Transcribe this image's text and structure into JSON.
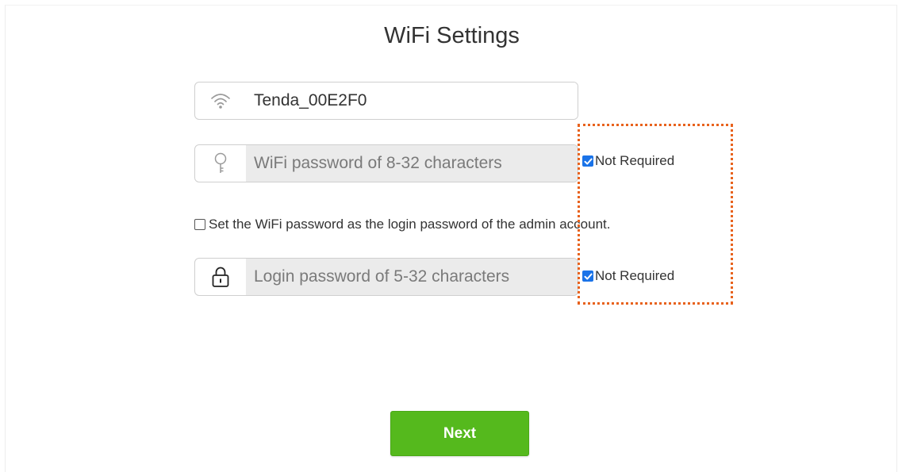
{
  "page": {
    "title": "WiFi Settings"
  },
  "wifi_name": {
    "icon": "wifi-icon",
    "value": "Tenda_00E2F0"
  },
  "wifi_password": {
    "icon": "key-icon",
    "placeholder": "WiFi password of 8-32 characters",
    "not_required_label": "Not Required",
    "not_required_checked": true
  },
  "admin_option": {
    "label": "Set the WiFi password as the login password of the admin account.",
    "checked": false
  },
  "login_password": {
    "icon": "lock-icon",
    "placeholder": "Login password of 5-32 characters",
    "not_required_label": "Not Required",
    "not_required_checked": true
  },
  "actions": {
    "next_label": "Next"
  },
  "colors": {
    "accent_green": "#55b91d",
    "checkbox_blue": "#1a73e8",
    "highlight_orange": "#e8621d"
  }
}
